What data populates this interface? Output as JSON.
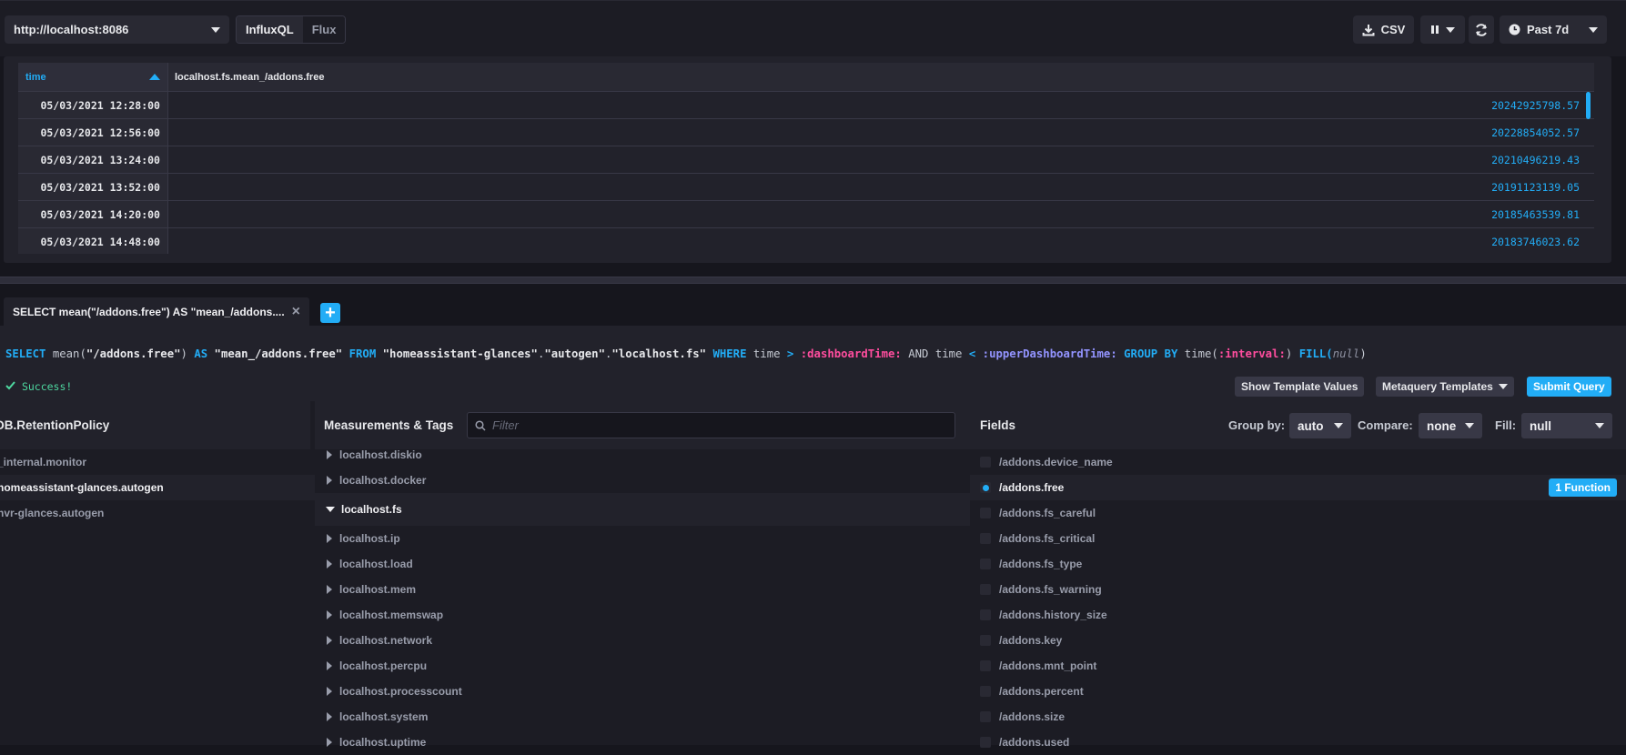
{
  "toolbar": {
    "source": "http://localhost:8086",
    "lang_influxql": "InfluxQL",
    "lang_flux": "Flux",
    "csv_label": "CSV",
    "time_range": "Past 7d"
  },
  "results": {
    "columns": [
      "time",
      "localhost.fs.mean_/addons.free"
    ],
    "rows": [
      {
        "time": "05/03/2021 12:28:00",
        "value": "20242925798.57"
      },
      {
        "time": "05/03/2021 12:56:00",
        "value": "20228854052.57"
      },
      {
        "time": "05/03/2021 13:24:00",
        "value": "20210496219.43"
      },
      {
        "time": "05/03/2021 13:52:00",
        "value": "20191123139.05"
      },
      {
        "time": "05/03/2021 14:20:00",
        "value": "20185463539.81"
      },
      {
        "time": "05/03/2021 14:48:00",
        "value": "20183746023.62"
      }
    ]
  },
  "query_tab": {
    "title": "SELECT mean(\"/addons.free\") AS \"mean_/addons....",
    "close": "×",
    "add": "+"
  },
  "editor": {
    "q_select": "SELECT",
    "q_mean": "mean(",
    "q_field": "\"/addons.free\"",
    "q_close_paren": ")",
    "q_as": "AS",
    "q_alias": "\"mean_/addons.free\"",
    "q_from": "FROM",
    "q_db": "\"homeassistant-glances\"",
    "q_dot1": ".",
    "q_rp": "\"autogen\"",
    "q_dot2": ".",
    "q_meas": "\"localhost.fs\"",
    "q_where": "WHERE",
    "q_time1": "time",
    "q_gt": ">",
    "q_dash_time": ":dashboardTime:",
    "q_and": "AND",
    "q_time2": "time",
    "q_lt": "<",
    "q_upper": ":upperDashboardTime:",
    "q_groupby": "GROUP BY",
    "q_timefn": "time(",
    "q_interval": ":interval:",
    "q_close2": ")",
    "q_fill": "FILL(",
    "q_null": "null",
    "q_close3": ")",
    "status": "Success!",
    "show_templates": "Show Template Values",
    "metaquery": "Metaquery Templates",
    "submit": "Submit Query"
  },
  "builder": {
    "db_header": "DB.RetentionPolicy",
    "databases": [
      {
        "label": "_internal.monitor",
        "selected": false
      },
      {
        "label": "homeassistant-glances.autogen",
        "selected": true
      },
      {
        "label": "nvr-glances.autogen",
        "selected": false
      }
    ],
    "meas_header": "Measurements & Tags",
    "filter_placeholder": "Filter",
    "measurements": [
      {
        "label": "localhost.diskio",
        "expanded": false
      },
      {
        "label": "localhost.docker",
        "expanded": false
      },
      {
        "label": "localhost.fs",
        "expanded": true
      },
      {
        "label": "localhost.ip",
        "expanded": false
      },
      {
        "label": "localhost.load",
        "expanded": false
      },
      {
        "label": "localhost.mem",
        "expanded": false
      },
      {
        "label": "localhost.memswap",
        "expanded": false
      },
      {
        "label": "localhost.network",
        "expanded": false
      },
      {
        "label": "localhost.percpu",
        "expanded": false
      },
      {
        "label": "localhost.processcount",
        "expanded": false
      },
      {
        "label": "localhost.system",
        "expanded": false
      },
      {
        "label": "localhost.uptime",
        "expanded": false
      }
    ],
    "fields_header": "Fields",
    "group_by_label": "Group by:",
    "group_by_value": "auto",
    "compare_label": "Compare:",
    "compare_value": "none",
    "fill_label": "Fill:",
    "fill_value": "null",
    "fields": [
      {
        "label": "/addons.device_name",
        "selected": false
      },
      {
        "label": "/addons.free",
        "selected": true,
        "badge": "1 Function"
      },
      {
        "label": "/addons.fs_careful",
        "selected": false
      },
      {
        "label": "/addons.fs_critical",
        "selected": false
      },
      {
        "label": "/addons.fs_type",
        "selected": false
      },
      {
        "label": "/addons.fs_warning",
        "selected": false
      },
      {
        "label": "/addons.history_size",
        "selected": false
      },
      {
        "label": "/addons.key",
        "selected": false
      },
      {
        "label": "/addons.mnt_point",
        "selected": false
      },
      {
        "label": "/addons.percent",
        "selected": false
      },
      {
        "label": "/addons.size",
        "selected": false
      },
      {
        "label": "/addons.used",
        "selected": false
      }
    ]
  }
}
